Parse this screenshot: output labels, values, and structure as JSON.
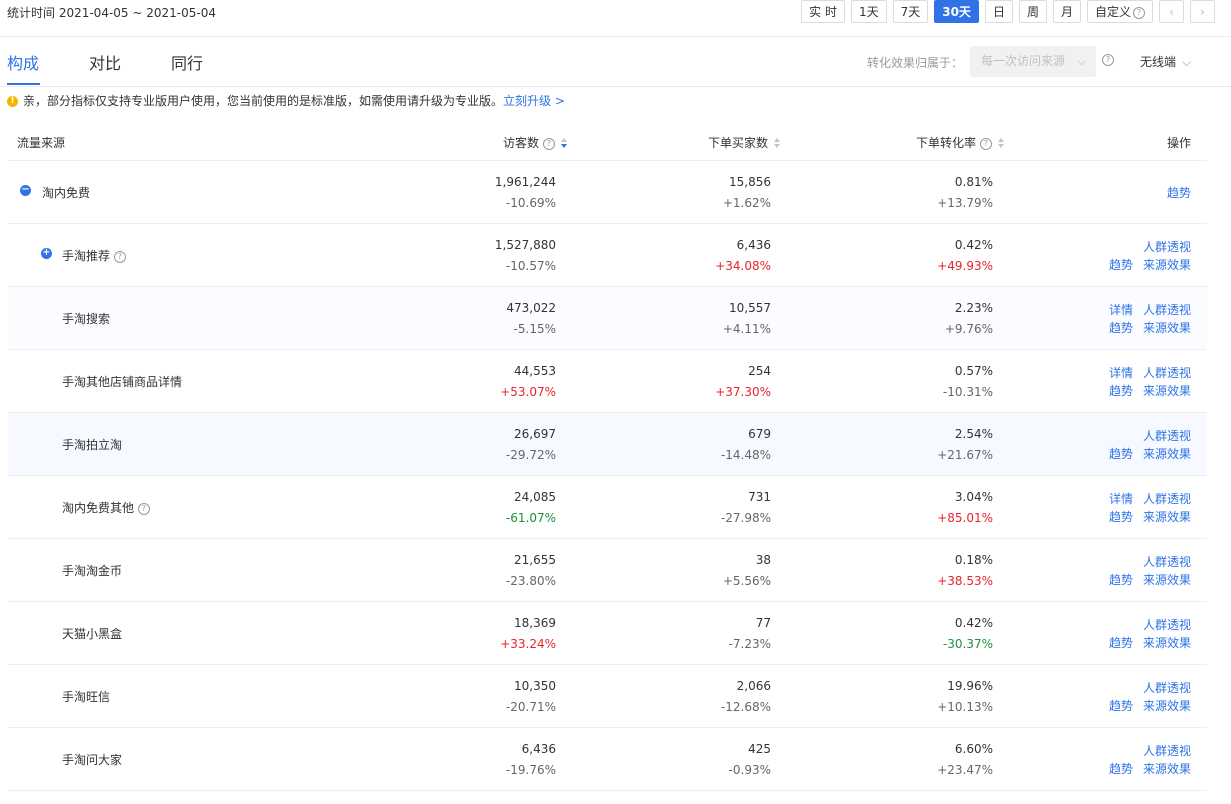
{
  "date_range": "统计时间 2021-04-05 ~ 2021-05-04",
  "range_buttons": [
    {
      "label": "实 时",
      "active": false
    },
    {
      "label": "1天",
      "active": false
    },
    {
      "label": "7天",
      "active": false
    },
    {
      "label": "30天",
      "active": true
    },
    {
      "label": "日",
      "active": false
    },
    {
      "label": "周",
      "active": false
    },
    {
      "label": "月",
      "active": false
    },
    {
      "label": "自定义",
      "active": false
    }
  ],
  "pager": {
    "prev": "‹",
    "next": "›"
  },
  "tabs": [
    "构成",
    "对比",
    "同行"
  ],
  "attribution": {
    "label": "转化效果归属于：",
    "value": "每一次访问来源",
    "device": "无线端"
  },
  "notice": {
    "text": "亲，部分指标仅支持专业版用户使用，您当前使用的是标准版，如需使用请升级为专业版。",
    "link": "立刻升级 >"
  },
  "table": {
    "headers": {
      "source": "流量来源",
      "visitors": "访客数",
      "buyers": "下单买家数",
      "rate": "下单转化率",
      "ops": "操作"
    },
    "rows": [
      {
        "name": "淘内免费",
        "toggle": "−",
        "visitors": "1,961,244",
        "visitors_chg": "-10.69%",
        "visitors_dir": "",
        "buyers": "15,856",
        "buyers_chg": "+1.62%",
        "buyers_dir": "",
        "rate": "0.81%",
        "rate_chg": "+13.79%",
        "rate_dir": "",
        "ops": [
          "趋势"
        ]
      },
      {
        "name": "手淘推荐",
        "toggle": "+",
        "help": true,
        "visitors": "1,527,880",
        "visitors_chg": "-10.57%",
        "visitors_dir": "",
        "buyers": "6,436",
        "buyers_chg": "+34.08%",
        "buyers_dir": "up",
        "rate": "0.42%",
        "rate_chg": "+49.93%",
        "rate_dir": "up",
        "ops": [
          "人群透视",
          "趋势",
          "来源效果"
        ]
      },
      {
        "name": "手淘搜索",
        "visitors": "473,022",
        "visitors_chg": "-5.15%",
        "visitors_dir": "",
        "buyers": "10,557",
        "buyers_chg": "+4.11%",
        "buyers_dir": "",
        "rate": "2.23%",
        "rate_chg": "+9.76%",
        "rate_dir": "",
        "ops": [
          "详情",
          "人群透视",
          "趋势",
          "来源效果"
        ]
      },
      {
        "name": "手淘其他店铺商品详情",
        "visitors": "44,553",
        "visitors_chg": "+53.07%",
        "visitors_dir": "up",
        "buyers": "254",
        "buyers_chg": "+37.30%",
        "buyers_dir": "up",
        "rate": "0.57%",
        "rate_chg": "-10.31%",
        "rate_dir": "",
        "ops": [
          "详情",
          "人群透视",
          "趋势",
          "来源效果"
        ]
      },
      {
        "name": "手淘拍立淘",
        "visitors": "26,697",
        "visitors_chg": "-29.72%",
        "visitors_dir": "",
        "buyers": "679",
        "buyers_chg": "-14.48%",
        "buyers_dir": "",
        "rate": "2.54%",
        "rate_chg": "+21.67%",
        "rate_dir": "",
        "ops": [
          "人群透视",
          "趋势",
          "来源效果"
        ]
      },
      {
        "name": "淘内免费其他",
        "help": true,
        "visitors": "24,085",
        "visitors_chg": "-61.07%",
        "visitors_dir": "down",
        "buyers": "731",
        "buyers_chg": "-27.98%",
        "buyers_dir": "",
        "rate": "3.04%",
        "rate_chg": "+85.01%",
        "rate_dir": "up",
        "ops": [
          "详情",
          "人群透视",
          "趋势",
          "来源效果"
        ]
      },
      {
        "name": "手淘淘金币",
        "visitors": "21,655",
        "visitors_chg": "-23.80%",
        "visitors_dir": "",
        "buyers": "38",
        "buyers_chg": "+5.56%",
        "buyers_dir": "",
        "rate": "0.18%",
        "rate_chg": "+38.53%",
        "rate_dir": "up",
        "ops": [
          "人群透视",
          "趋势",
          "来源效果"
        ]
      },
      {
        "name": "天猫小黑盒",
        "visitors": "18,369",
        "visitors_chg": "+33.24%",
        "visitors_dir": "up",
        "buyers": "77",
        "buyers_chg": "-7.23%",
        "buyers_dir": "",
        "rate": "0.42%",
        "rate_chg": "-30.37%",
        "rate_dir": "down",
        "ops": [
          "人群透视",
          "趋势",
          "来源效果"
        ]
      },
      {
        "name": "手淘旺信",
        "visitors": "10,350",
        "visitors_chg": "-20.71%",
        "visitors_dir": "",
        "buyers": "2,066",
        "buyers_chg": "-12.68%",
        "buyers_dir": "",
        "rate": "19.96%",
        "rate_chg": "+10.13%",
        "rate_dir": "",
        "ops": [
          "人群透视",
          "趋势",
          "来源效果"
        ]
      },
      {
        "name": "手淘问大家",
        "visitors": "6,436",
        "visitors_chg": "-19.76%",
        "visitors_dir": "",
        "buyers": "425",
        "buyers_chg": "-0.93%",
        "buyers_dir": "",
        "rate": "6.60%",
        "rate_chg": "+23.47%",
        "rate_dir": "",
        "ops": [
          "人群透视",
          "趋势",
          "来源效果"
        ]
      }
    ]
  }
}
